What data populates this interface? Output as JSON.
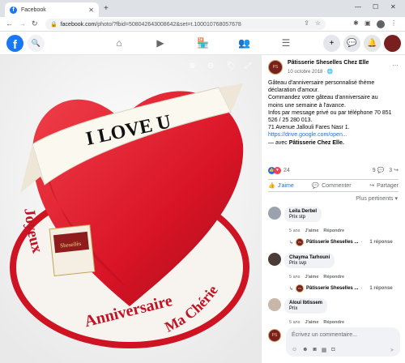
{
  "browser": {
    "tab_title": "Facebook",
    "url_host": "facebook.com",
    "url_path": "/photo/?fbid=508042643008642&set=t.100010768057678",
    "new_tab": "+",
    "win_min": "—",
    "win_max": "☐",
    "win_close": "✕"
  },
  "facebook": {
    "logo": "f"
  },
  "photo": {
    "banner_text": "I LOVE U",
    "arc_text_left": "Joyeux",
    "arc_text_bottom": "Anniversaire",
    "arc_text_right": "Ma Chérie",
    "box_brand": "Shesellès"
  },
  "post": {
    "page_name": "Pâtisserie Sheselles Chez Elle",
    "date": "10 octobre 2018 · ",
    "globe": "🌐",
    "lines": [
      "Gâteau d'anniversaire personnalisé thème",
      "déclaration d'amour.",
      "Commandez votre gâteau d'anniversaire au",
      "moins une semaine à l'avance.",
      "Infos par message privé ou par téléphone 70 851",
      "526 / 25 280 013.",
      "71 Avenue Jallouli Fares Nasr 1."
    ],
    "link": "https://drive.google.com/open...",
    "with_prefix": "— avec ",
    "with_page": "Pâtisserie Chez Elle.",
    "reaction_count": "24",
    "comment_count": "9",
    "share_count": "3",
    "like_label": "J'aime",
    "comment_label": "Commenter",
    "share_label": "Partager",
    "sort_label": "Plus pertinents ▾",
    "colors": {
      "like_blue": "#216fdb",
      "heart_red": "#f33e58"
    }
  },
  "comments": [
    {
      "name": "Leila Derbel",
      "text": "Prix stp",
      "time": "5 ans",
      "like": "J'aime",
      "reply": "Répondre",
      "reply_author": "Pâtisserie Sheselles ...",
      "reply_count": "1 réponse"
    },
    {
      "name": "Chayma Tarhouni",
      "text": "Prix svp",
      "time": "5 ans",
      "like": "J'aime",
      "reply": "Répondre",
      "reply_author": "Pâtisserie Sheselles ...",
      "reply_count": "1 réponse"
    },
    {
      "name": "Aloui Ibtissem",
      "text": "Prix",
      "time": "5 ans",
      "like": "J'aime",
      "reply": "Répondre"
    }
  ],
  "composer": {
    "placeholder": "Écrivez un commentaire..."
  }
}
